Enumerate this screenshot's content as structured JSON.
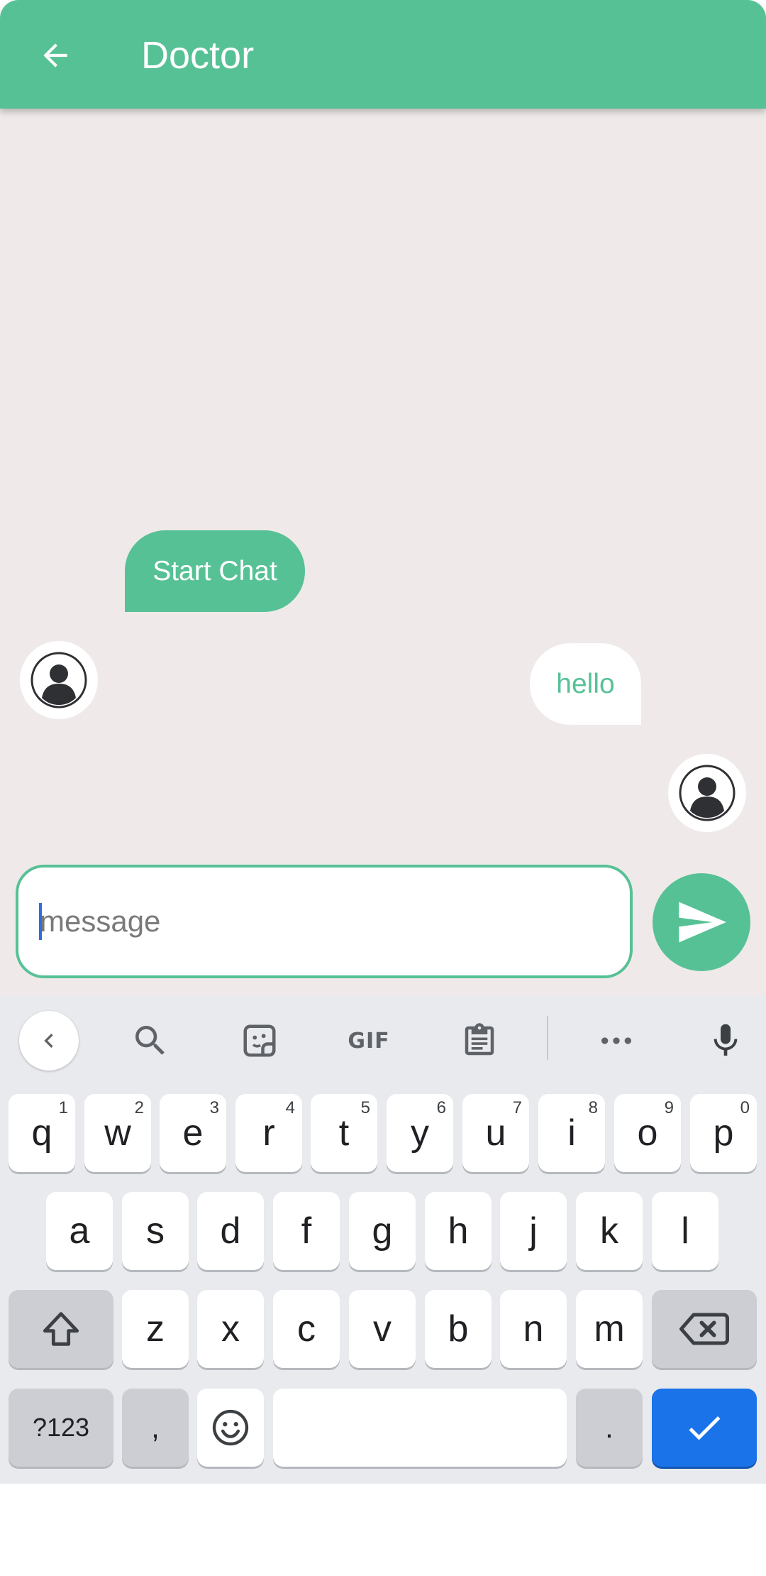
{
  "app_bar": {
    "title": "Doctor",
    "back_icon": "arrow-back-icon"
  },
  "colors": {
    "primary": "#57c196",
    "chat_bg": "#efeae9",
    "keyboard_bg": "#e8eaed",
    "enter_key": "#1a73e8"
  },
  "messages": [
    {
      "side": "incoming",
      "text": "Start Chat"
    },
    {
      "side": "outgoing",
      "text": "hello"
    }
  ],
  "composer": {
    "placeholder": "message",
    "value": ""
  },
  "keyboard": {
    "toolbar": [
      "collapse",
      "search",
      "sticker",
      "GIF",
      "clipboard",
      "more",
      "voice"
    ],
    "gif_label": "GIF",
    "row1": [
      {
        "k": "q",
        "n": "1"
      },
      {
        "k": "w",
        "n": "2"
      },
      {
        "k": "e",
        "n": "3"
      },
      {
        "k": "r",
        "n": "4"
      },
      {
        "k": "t",
        "n": "5"
      },
      {
        "k": "y",
        "n": "6"
      },
      {
        "k": "u",
        "n": "7"
      },
      {
        "k": "i",
        "n": "8"
      },
      {
        "k": "o",
        "n": "9"
      },
      {
        "k": "p",
        "n": "0"
      }
    ],
    "row2": [
      "a",
      "s",
      "d",
      "f",
      "g",
      "h",
      "j",
      "k",
      "l"
    ],
    "row3": [
      "z",
      "x",
      "c",
      "v",
      "b",
      "n",
      "m"
    ],
    "symbols_label": "?123",
    "comma": ",",
    "period": "."
  }
}
